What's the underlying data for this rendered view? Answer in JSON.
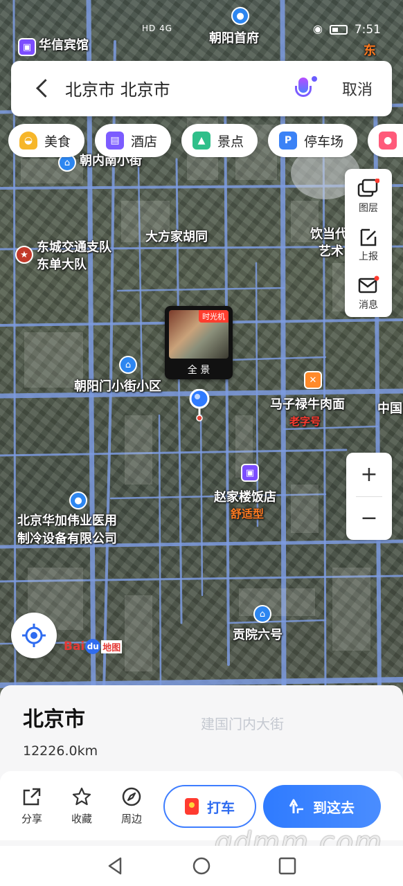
{
  "status_bar": {
    "time": "7:51",
    "signal": "HD 4G"
  },
  "search": {
    "query": "北京市 北京市",
    "cancel_label": "取消"
  },
  "chips": [
    {
      "label": "美食",
      "icon": "food-icon",
      "color": "#f6b62a"
    },
    {
      "label": "酒店",
      "icon": "hotel-icon",
      "color": "#7c5cff"
    },
    {
      "label": "景点",
      "icon": "scenic-icon",
      "color": "#2fbf8a"
    },
    {
      "label": "停车场",
      "icon": "parking-icon",
      "color": "#3b82f6"
    }
  ],
  "tools": {
    "layers": "图层",
    "report": "上报",
    "messages": "消息"
  },
  "map_labels": {
    "huaxin_hotel": "华信宾馆",
    "chaoyang_shoufu": "朝阳首府",
    "chaonei_nanxiaojie": "朝内南小街",
    "dongcheng_traffic_1": "东城交通支队",
    "dongcheng_traffic_2": "东单大队",
    "dafangjia": "大方家胡同",
    "yindang_1": "饮当代",
    "yindang_2": "艺术",
    "chaoyangmen": "朝阳门小街小区",
    "mazilu_beef": "马子禄牛肉面",
    "laozihao": "老字号",
    "zhong": "中国",
    "zhaojialou": "赵家楼饭店",
    "shushiying": "舒适型",
    "huajia_1": "北京华加伟业医用",
    "huajia_2": "制冷设备有限公司",
    "gongyuan": "贡院六号",
    "jianguomen": "建国门内大街",
    "dong_edge": "东"
  },
  "panorama": {
    "tag": "时光机",
    "label": "全 景"
  },
  "brand": {
    "bai": "Bai",
    "du": "du",
    "map": "地图"
  },
  "place": {
    "name": "北京市",
    "distance": "12226.0km"
  },
  "actions": {
    "share": "分享",
    "favorite": "收藏",
    "nearby": "周边",
    "taxi": "打车",
    "go": "到这去"
  },
  "watermark": "gdmm.com"
}
